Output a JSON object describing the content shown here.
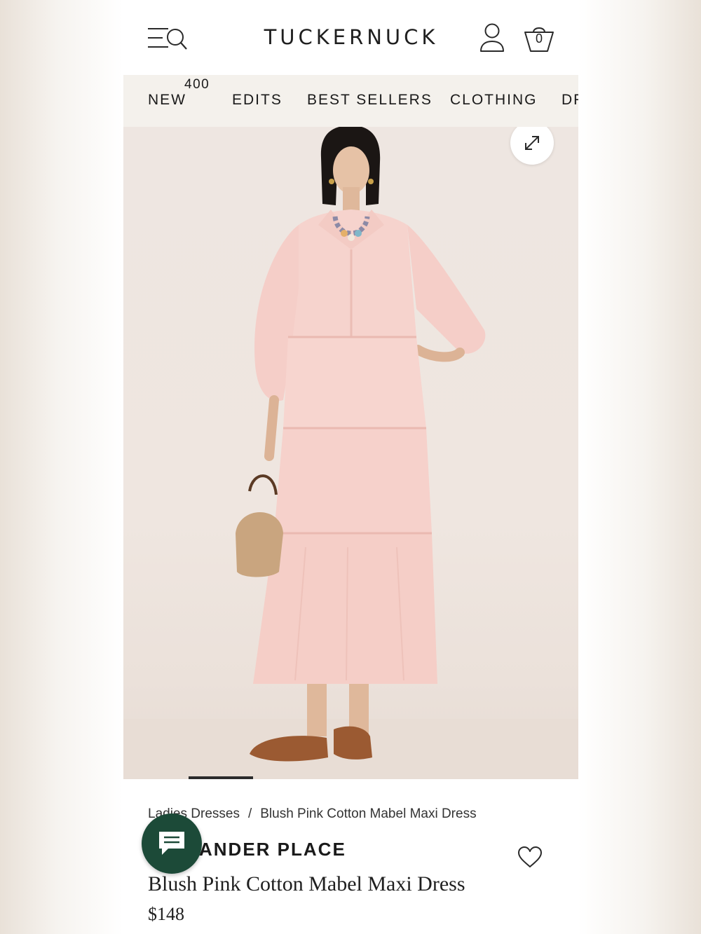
{
  "header": {
    "logo": "TUCKERNUCK",
    "bag_count": "0"
  },
  "nav": {
    "items": [
      {
        "label": "NEW",
        "badge": "400"
      },
      {
        "label": "EDITS"
      },
      {
        "label": "BEST SELLERS"
      },
      {
        "label": "CLOTHING"
      },
      {
        "label": "DR"
      }
    ]
  },
  "gallery": {
    "image_alt": "Model wearing blush pink tiered cotton maxi dress with beaded necklace, woven bag and brown slide sandals",
    "progress_fraction": 0.14
  },
  "product": {
    "breadcrumb": [
      "Ladies Dresses",
      "Blush Pink Cotton Mabel Maxi Dress"
    ],
    "breadcrumb_separator": "/",
    "brand": "ANDER PLACE",
    "title": "Blush Pink Cotton Mabel Maxi Dress",
    "price": "$148"
  },
  "colors": {
    "chat_button": "#1c4a38",
    "nav_background": "#f4f1ec",
    "dress": "#f6cfc8"
  },
  "icons": [
    "menu-search-icon",
    "account-icon",
    "shopping-bag-icon",
    "expand-icon",
    "heart-icon",
    "chat-icon"
  ]
}
